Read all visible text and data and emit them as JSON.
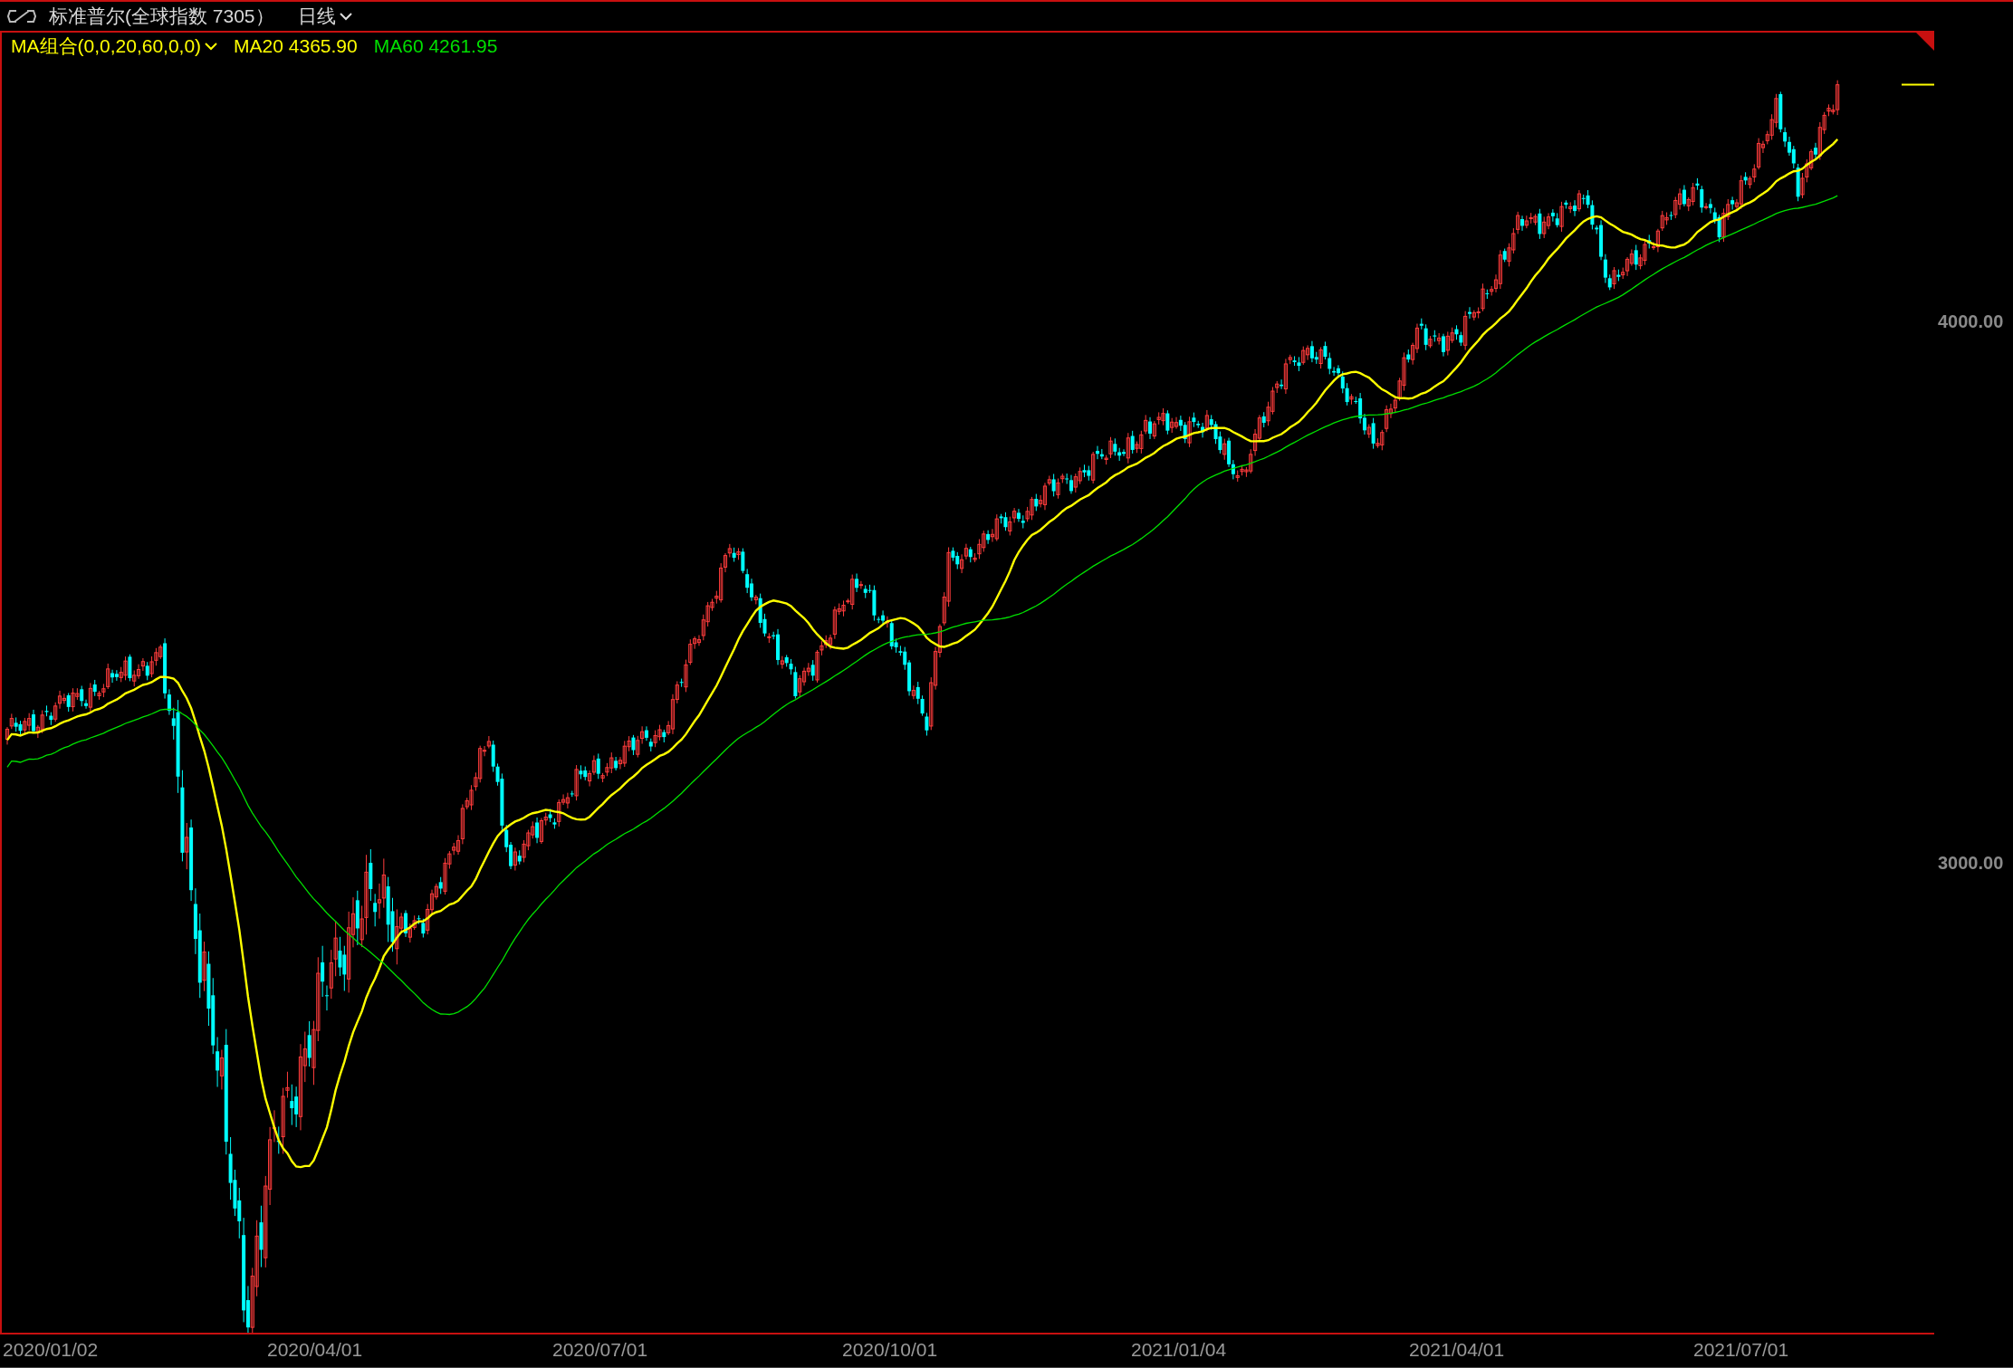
{
  "header": {
    "title": "标准普尔(全球指数 7305）",
    "period": "日线"
  },
  "legend": {
    "indicator": "MA组合(0,0,20,60,0,0)",
    "lines": [
      {
        "label": "MA20 4365.90",
        "color": "#ffff00"
      },
      {
        "label": "MA60 4261.95",
        "color": "#00e000"
      }
    ]
  },
  "y_axis": [
    {
      "label": "4000.00"
    },
    {
      "label": "3000.00"
    }
  ],
  "x_axis": [
    {
      "label": "2020/01/02"
    },
    {
      "label": "2020/04/01"
    },
    {
      "label": "2020/07/01"
    },
    {
      "label": "2020/10/01"
    },
    {
      "label": "2021/01/04"
    },
    {
      "label": "2021/04/01"
    },
    {
      "label": "2021/07/01"
    }
  ]
}
